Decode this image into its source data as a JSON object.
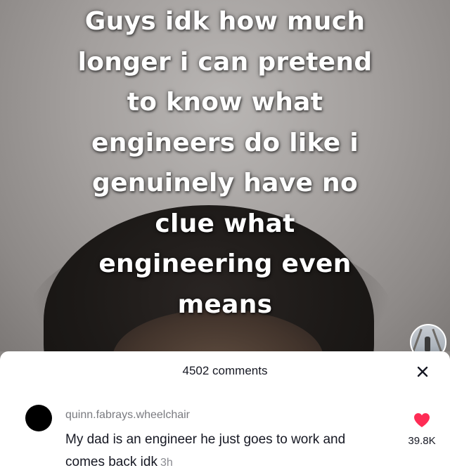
{
  "video": {
    "caption_lines": [
      "Guys idk how much",
      "longer i can pretend",
      "to know what",
      "engineers do like i",
      "genuinely have no",
      "clue what",
      "engineering even",
      "means"
    ]
  },
  "comments_panel": {
    "title": "4502 comments",
    "comment": {
      "username": "quinn.fabrays.wheelchair",
      "text": "My dad is an engineer he just goes to work and comes back idk",
      "time": "3h",
      "like_count": "39.8K"
    }
  },
  "colors": {
    "like_heart": "#fe2c55",
    "panel_bg": "#ffffff",
    "text_primary": "#161823",
    "text_secondary": "#7a7b80"
  },
  "icons": {
    "close": "close-icon",
    "like": "heart-icon"
  }
}
